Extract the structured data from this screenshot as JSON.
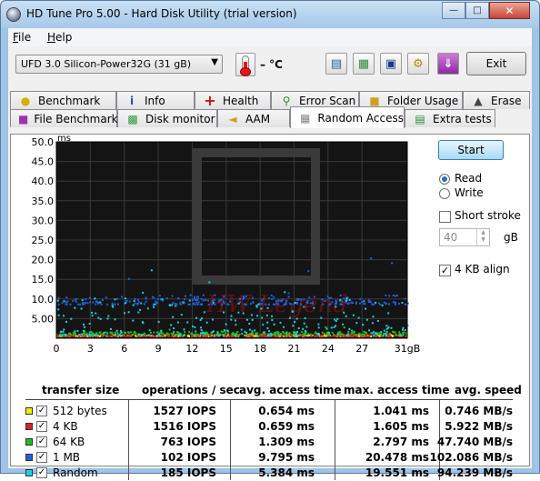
{
  "window": {
    "title": "HD Tune Pro 5.00 - Hard Disk Utility (trial version)"
  },
  "menu": [
    {
      "label": "File",
      "key": "F",
      "rest": "ile"
    },
    {
      "label": "Help",
      "key": "H",
      "rest": "elp"
    }
  ],
  "toolbar": {
    "drive": "UFD 3.0 Silicon-Power32G (31 gB)",
    "temperature": "– °C",
    "exit_label": "Exit",
    "buttons": [
      "copy-info-icon",
      "copy-screenshot-icon",
      "save-icon",
      "options-icon",
      "download-icon"
    ]
  },
  "tabs_top": [
    {
      "label": "Benchmark",
      "icon": "benchmark-icon"
    },
    {
      "label": "Info",
      "icon": "info-icon"
    },
    {
      "label": "Health",
      "icon": "health-icon"
    },
    {
      "label": "Error Scan",
      "icon": "error-scan-icon"
    },
    {
      "label": "Folder Usage",
      "icon": "folder-icon"
    },
    {
      "label": "Erase",
      "icon": "erase-icon"
    }
  ],
  "tabs_bottom": [
    {
      "label": "File Benchmark",
      "icon": "file-benchmark-icon"
    },
    {
      "label": "Disk monitor",
      "icon": "disk-monitor-icon"
    },
    {
      "label": "AAM",
      "icon": "aam-icon"
    },
    {
      "label": "Random Access",
      "icon": "random-access-icon",
      "active": true
    },
    {
      "label": "Extra tests",
      "icon": "extra-tests-icon"
    }
  ],
  "side": {
    "start_label": "Start",
    "read_label": "Read",
    "write_label": "Write",
    "mode": "Read",
    "short_stroke_label": "Short stroke",
    "short_stroke_checked": false,
    "short_stroke_value": "40",
    "short_stroke_unit": "gB",
    "align_label": "4 KB align",
    "align_checked": true
  },
  "results": {
    "headers": [
      "transfer size",
      "operations / sec",
      "avg. access time",
      "max. access time",
      "avg. speed"
    ],
    "rows": [
      {
        "size": "512 bytes",
        "color": "#f0f000",
        "ops": "1527 IOPS",
        "avg": "0.654 ms",
        "max": "1.041 ms",
        "speed": "0.746 MB/s"
      },
      {
        "size": "4 KB",
        "color": "#e02020",
        "ops": "1516 IOPS",
        "avg": "0.659 ms",
        "max": "1.605 ms",
        "speed": "5.922 MB/s"
      },
      {
        "size": "64 KB",
        "color": "#20c020",
        "ops": "763 IOPS",
        "avg": "1.309 ms",
        "max": "2.797 ms",
        "speed": "47.740 MB/s"
      },
      {
        "size": "1 MB",
        "color": "#2060e0",
        "ops": "102 IOPS",
        "avg": "9.795 ms",
        "max": "20.478 ms",
        "speed": "102.086 MB/s"
      },
      {
        "size": "Random",
        "color": "#20d0e0",
        "ops": "185 IOPS",
        "avg": "5.384 ms",
        "max": "19.551 ms",
        "speed": "94.239 MB/s"
      }
    ]
  },
  "chart_data": {
    "type": "scatter",
    "title": "",
    "xlabel": "",
    "ylabel": "ms",
    "xlim": [
      0,
      31
    ],
    "ylim": [
      0,
      50
    ],
    "y_ticks": [
      "5.00",
      "10.0",
      "15.0",
      "20.0",
      "25.0",
      "30.0",
      "35.0",
      "40.0",
      "45.0",
      "50.0"
    ],
    "x_ticks": [
      "0",
      "3",
      "6",
      "9",
      "12",
      "15",
      "18",
      "21",
      "24",
      "27",
      "31gB"
    ],
    "grid": true,
    "watermark": "HW Legend",
    "series": [
      {
        "name": "512 bytes",
        "color": "#f0f000",
        "avg": 0.654,
        "max": 1.041,
        "min": 0.5
      },
      {
        "name": "4 KB",
        "color": "#e02020",
        "avg": 0.659,
        "max": 1.605,
        "min": 0.5
      },
      {
        "name": "64 KB",
        "color": "#20c020",
        "avg": 1.309,
        "max": 2.797,
        "min": 0.9
      },
      {
        "name": "1 MB",
        "color": "#2060e0",
        "avg": 9.795,
        "max": 20.478,
        "min": 8.6
      },
      {
        "name": "Random",
        "color": "#20d0e0",
        "avg": 5.384,
        "max": 19.551,
        "min": 0.6
      }
    ]
  }
}
